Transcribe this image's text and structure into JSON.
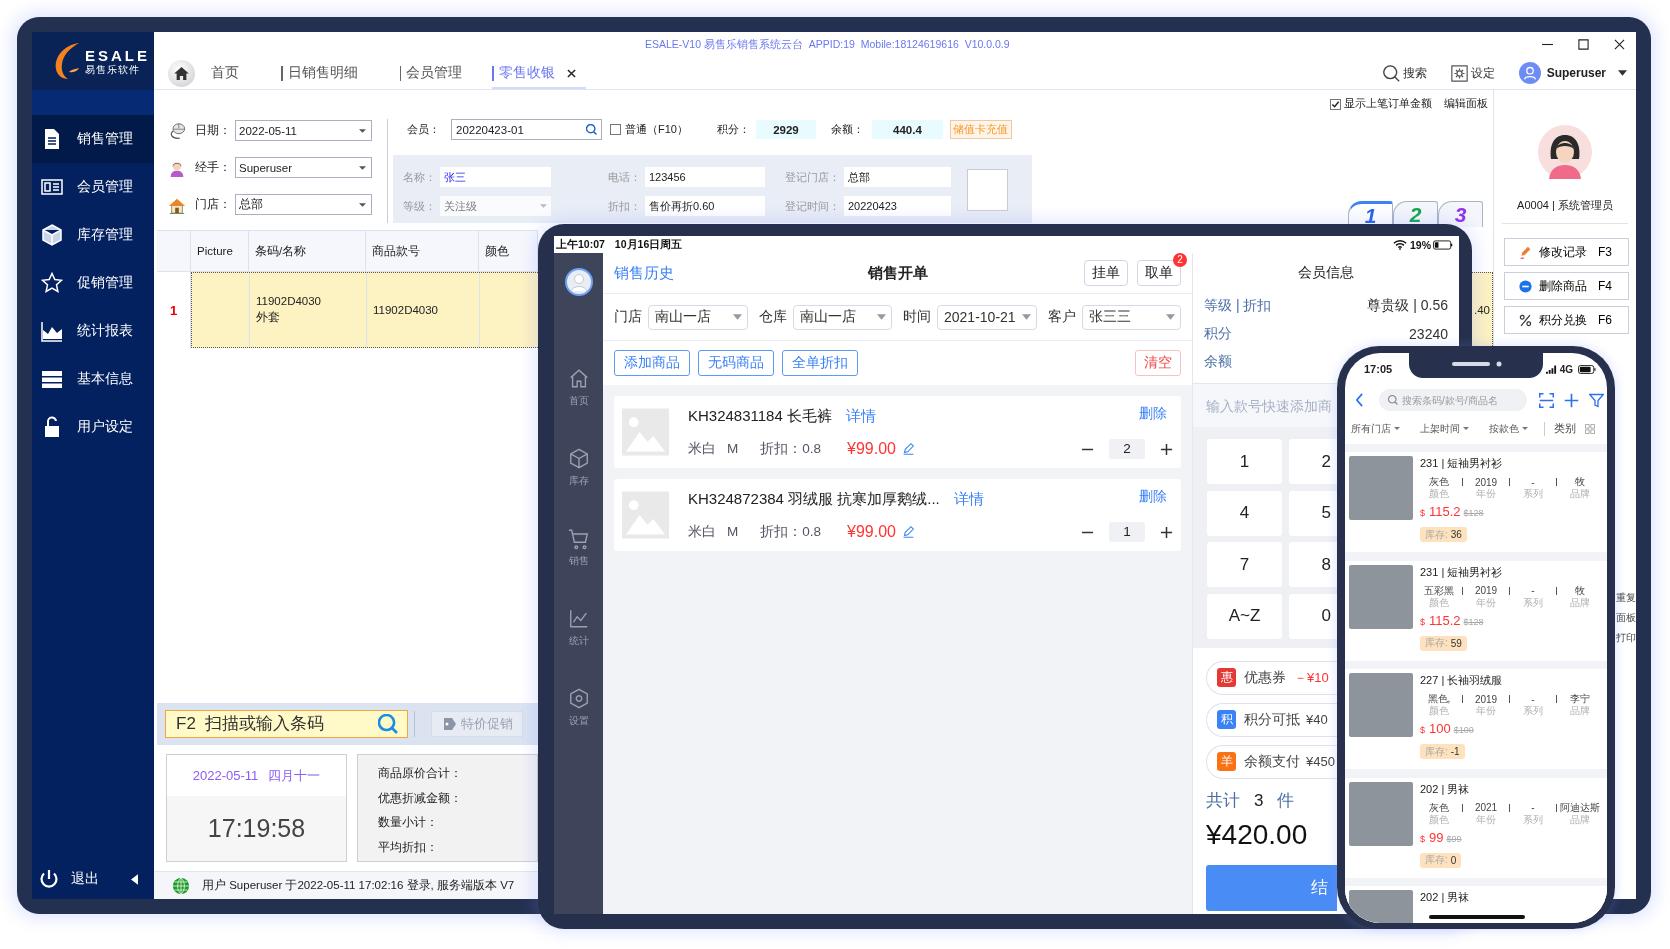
{
  "desktop": {
    "title": "ESALE-V10 易售乐销售系统云台  APPID:19  Mobile:18124619616  V10.0.0.9",
    "logo": {
      "brand": "ESALE",
      "tagline": "易售乐软件"
    },
    "sidebar": {
      "items": [
        {
          "label": "销售管理",
          "kind": "document",
          "selected": true
        },
        {
          "label": "会员管理",
          "kind": "card",
          "selected": false
        },
        {
          "label": "库存管理",
          "kind": "box",
          "selected": false
        },
        {
          "label": "促销管理",
          "kind": "star",
          "selected": false
        },
        {
          "label": "统计报表",
          "kind": "chart",
          "selected": false
        },
        {
          "label": "基本信息",
          "kind": "list",
          "selected": false
        },
        {
          "label": "用户设定",
          "kind": "lock",
          "selected": false
        }
      ],
      "exit": "退出"
    },
    "tabs": [
      {
        "label": "首页",
        "selected": false,
        "closable": false
      },
      {
        "label": "日销售明细",
        "selected": false,
        "closable": false
      },
      {
        "label": "会员管理",
        "selected": false,
        "closable": false
      },
      {
        "label": "零售收银",
        "selected": true,
        "closable": true
      }
    ],
    "toolbar": [
      {
        "label": "搜索",
        "kind": "search"
      },
      {
        "label": "设定",
        "kind": "settings"
      }
    ],
    "user": "Superuser",
    "show_last_order": {
      "label": "显示上笔订单金额",
      "checked": true
    },
    "edit_panel": "编辑面板",
    "fields": [
      {
        "kind": "date",
        "label": "日期：",
        "value": "2022-05-11"
      },
      {
        "kind": "person",
        "label": "经手：",
        "value": "Superuser"
      },
      {
        "kind": "store",
        "label": "门店：",
        "value": "总部"
      }
    ],
    "member": {
      "label": "会员：",
      "value": "20220423-01",
      "normal": {
        "label": "普通（F10）",
        "checked": false
      },
      "points": {
        "label": "积分：",
        "value": "2929"
      },
      "balance": {
        "label": "余额：",
        "value": "440.4"
      },
      "recharge": "储值卡充值",
      "details": [
        {
          "label": "名称：",
          "value": "张三",
          "kind": "name"
        },
        {
          "label": "电话：",
          "value": "123456",
          "kind": "text"
        },
        {
          "label": "登记门店：",
          "value": "总部",
          "kind": "text"
        },
        {
          "label": "等级：",
          "value": "关注级",
          "kind": "select"
        },
        {
          "label": "折扣：",
          "value": "售价再折0.60",
          "kind": "text"
        },
        {
          "label": "登记时间：",
          "value": "20220423",
          "kind": "text"
        }
      ]
    },
    "order_tabs": [
      {
        "label": "1",
        "color": "#2563eb",
        "selected": true
      },
      {
        "label": "2",
        "color": "#16a34a",
        "selected": false
      },
      {
        "label": "3",
        "color": "#9333ea",
        "selected": false
      }
    ],
    "table": {
      "columns": [
        "Picture",
        "条码/名称",
        "商品款号",
        "颜色"
      ],
      "rows": [
        {
          "index": "1",
          "selected": true,
          "barcode": "11902D4030",
          "name": "外套",
          "style_no": "11902D4030",
          "tail": ".40"
        }
      ]
    },
    "operator": "A0004 | 系统管理员",
    "actions": [
      {
        "kind": "edit",
        "label": "修改记录",
        "key": "F3"
      },
      {
        "kind": "remove",
        "label": "删除商品",
        "key": "F4"
      },
      {
        "kind": "percent",
        "label": "积分兑换",
        "key": "F6"
      }
    ],
    "side_fragments": [
      "重复",
      "面板",
      "打印"
    ],
    "scan": {
      "placeholder": "F2  扫描或输入条码"
    },
    "promo": {
      "label": "特价促销",
      "disabled": true
    },
    "clock": {
      "date": "2022-05-11",
      "lunar": "四月十一",
      "time": "17:19:58"
    },
    "summary": [
      "商品原价合计：",
      "优惠折减金额：",
      "数量小计：",
      "平均折扣："
    ],
    "status_bar": "用户 Superuser 于2022-05-11 17:02:16 登录, 服务端版本 V7"
  },
  "tablet": {
    "status": {
      "time": "上午10:07",
      "date": "10月16日周五",
      "battery": "19%"
    },
    "nav": [
      {
        "kind": "home",
        "label": "首页"
      },
      {
        "kind": "box",
        "label": "库存"
      },
      {
        "kind": "cart",
        "label": "销售"
      },
      {
        "kind": "chart",
        "label": "统计"
      },
      {
        "kind": "settings",
        "label": "设置"
      }
    ],
    "history": "销售历史",
    "title": "销售开单",
    "buttons": [
      {
        "label": "挂单"
      },
      {
        "label": "取单",
        "badge": "2"
      }
    ],
    "filters": [
      {
        "label": "门店",
        "value": "南山一店"
      },
      {
        "label": "仓库",
        "value": "南山一店"
      },
      {
        "label": "时间",
        "value": "2021-10-21"
      },
      {
        "label": "客户",
        "value": "张三三"
      }
    ],
    "actions": [
      {
        "label": "添加商品",
        "kind": "outline"
      },
      {
        "label": "无码商品",
        "kind": "outline"
      },
      {
        "label": "全单折扣",
        "kind": "outline"
      },
      {
        "label": "清空",
        "kind": "danger"
      }
    ],
    "items": [
      {
        "code": "KH324831184 长毛裤",
        "detail": "详情",
        "delete": "删除",
        "variant": "米白",
        "size": "M",
        "discount": "折扣：0.8",
        "price": "¥99.00",
        "qty": "2"
      },
      {
        "code": "KH324872384 羽绒服 抗寒加厚鹅绒...",
        "detail": "详情",
        "delete": "删除",
        "variant": "米白",
        "size": "M",
        "discount": "折扣：0.8",
        "price": "¥99.00",
        "qty": "1"
      }
    ],
    "member": {
      "title": "会员信息",
      "rows": [
        {
          "label": "等级 | 折扣",
          "value": "尊贵级 | 0.56"
        },
        {
          "label": "积分",
          "value": "23240"
        },
        {
          "label": "余额"
        }
      ]
    },
    "quick_add": {
      "placeholder": "输入款号快速添加商"
    },
    "keypad": [
      "1",
      "2",
      "4",
      "5",
      "7",
      "8",
      "A~Z",
      "0"
    ],
    "payments": [
      {
        "kind": "coupon",
        "badge": "惠",
        "color": "#e53935",
        "label": "优惠券",
        "amount": "－¥10"
      },
      {
        "kind": "points",
        "badge": "积",
        "color": "#3b82f6",
        "label": "积分可抵",
        "amount": "¥40"
      },
      {
        "kind": "balance",
        "badge": "羊",
        "color": "#f97316",
        "label": "余额支付",
        "amount": "¥450"
      }
    ],
    "total": {
      "label": "共计",
      "count": "3",
      "unit": "件",
      "amount": "¥420.00"
    },
    "checkout": "结"
  },
  "phone": {
    "time": "17:05",
    "network": "4G",
    "search": {
      "placeholder": "搜索条码/款号/商品名"
    },
    "filters": [
      {
        "label": "所有门店",
        "kind": "dropdown"
      },
      {
        "label": "上架时间",
        "kind": "dropdown"
      },
      {
        "label": "按款色",
        "kind": "dropdown"
      },
      {
        "label": "类别",
        "kind": "grid"
      }
    ],
    "products": [
      {
        "title": "231 | 短袖男衬衫",
        "attrs": [
          {
            "value": "灰色",
            "label": "颜色"
          },
          {
            "value": "2019",
            "label": "年份"
          },
          {
            "value": "-",
            "label": "系列"
          },
          {
            "value": "牧",
            "label": "品牌"
          }
        ],
        "currency": "$",
        "price": "115.2",
        "original": "$128",
        "stock_label": "库存:",
        "stock": "36"
      },
      {
        "title": "231 | 短袖男衬衫",
        "attrs": [
          {
            "value": "五彩黑",
            "label": "颜色"
          },
          {
            "value": "2019",
            "label": "年份"
          },
          {
            "value": "-",
            "label": "系列"
          },
          {
            "value": "牧",
            "label": "品牌"
          }
        ],
        "currency": "$",
        "price": "115.2",
        "original": "$128",
        "stock_label": "库存:",
        "stock": "59"
      },
      {
        "title": "227 | 长袖羽绒服",
        "attrs": [
          {
            "value": "黑色,",
            "label": "颜色"
          },
          {
            "value": "2019",
            "label": "年份"
          },
          {
            "value": "-",
            "label": "系列"
          },
          {
            "value": "李宁",
            "label": "品牌"
          }
        ],
        "currency": "$",
        "price": "100",
        "original": "$100",
        "stock_label": "库存:",
        "stock": "-1"
      },
      {
        "title": "202 | 男袜",
        "attrs": [
          {
            "value": "灰色",
            "label": "颜色"
          },
          {
            "value": "2021",
            "label": "年份"
          },
          {
            "value": "-",
            "label": "系列"
          },
          {
            "value": "阿迪达斯",
            "label": "品牌"
          }
        ],
        "currency": "$",
        "price": "99",
        "original": "$99",
        "stock_label": "库存:",
        "stock": "0"
      },
      {
        "title": "202 | 男袜"
      }
    ]
  }
}
